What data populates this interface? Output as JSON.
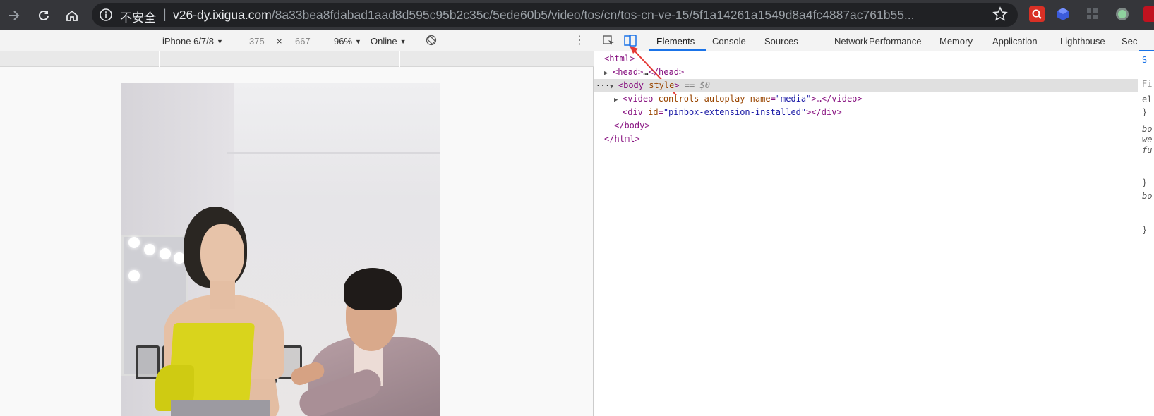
{
  "browser": {
    "security_label": "不安全",
    "url_host": "v26-dy.ixigua.com",
    "url_path": "/8a33bea8fdabad1aad8d595c95b2c35c/5ede60b5/video/tos/cn/tos-cn-ve-15/5f1a14261a1549d8a4fc4887ac761b55...",
    "colors": {
      "bar": "#35363a",
      "omnibox": "#202124"
    }
  },
  "device_toolbar": {
    "device": "iPhone 6/7/8",
    "width": "375",
    "times": "×",
    "height": "667",
    "zoom": "96%",
    "throttle": "Online"
  },
  "devtools": {
    "tabs": [
      "Elements",
      "Console",
      "Sources",
      "Network",
      "Performance",
      "Memory",
      "Application",
      "Lighthouse",
      "Secur"
    ],
    "active_tab": "Elements",
    "dom": {
      "html_open": "<html>",
      "head_open": "<head>",
      "head_ellipsis": "…",
      "head_close": "</head>",
      "body_open_tag": "<body",
      "body_attr": "style",
      "body_gt": ">",
      "body_eq": "== $0",
      "video_open": "<video",
      "video_attrs": "controls autoplay",
      "video_name_attr": "name",
      "video_name_val": "\"media\"",
      "video_close": ">…</video>",
      "div_open": "<div",
      "div_id_attr": "id",
      "div_id_val": "\"pinbox-extension-installed\"",
      "div_close": "></div>",
      "body_close": "</body>",
      "html_close": "</html>"
    },
    "styles_peek": [
      "S",
      "Fi",
      "el",
      "}",
      "bo",
      "we",
      "fu",
      "}",
      "bo",
      "}"
    ]
  }
}
